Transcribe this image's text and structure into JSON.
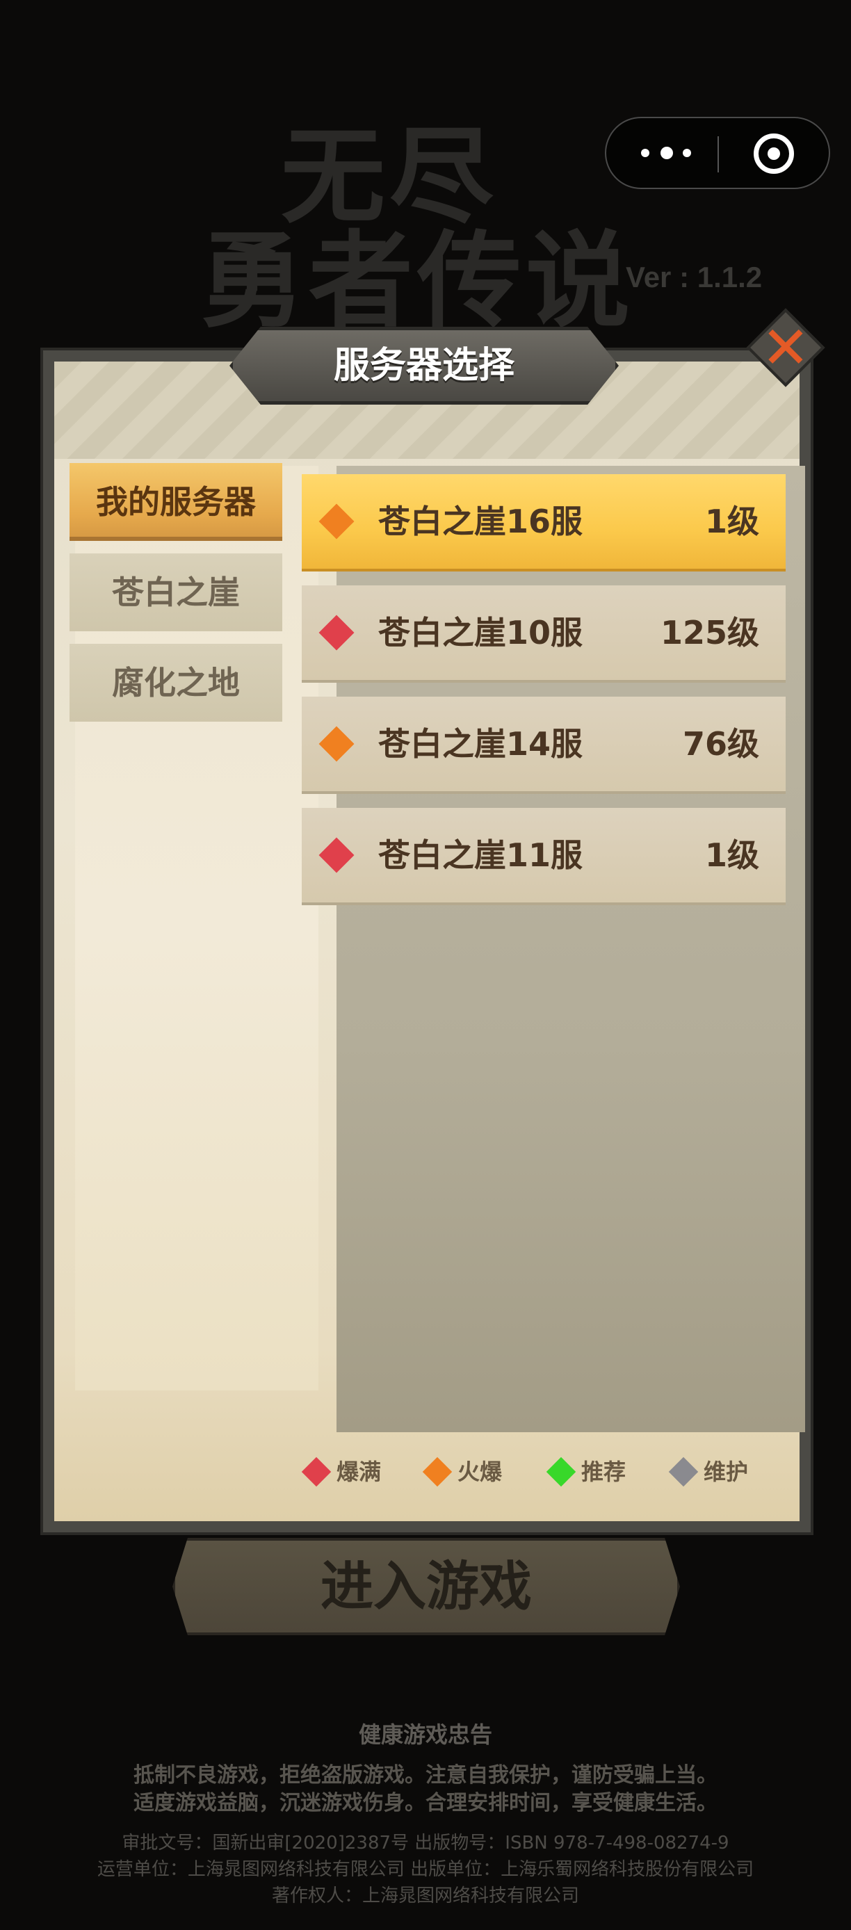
{
  "colors": {
    "accent_selected": "#fbc94b",
    "close_x": "#e45a26",
    "gem_full": "#e0404b",
    "gem_hot": "#f08020",
    "gem_recommend": "#38d82a",
    "gem_maintenance": "#8a8a8f"
  },
  "capsule": {
    "more_icon": "more-dots-icon",
    "close_icon": "target-icon"
  },
  "logo": {
    "line1": "无尽",
    "line2": "勇者传说",
    "version": "Ver : 1.1.2"
  },
  "dialog": {
    "title": "服务器选择",
    "close_icon": "close-x-icon",
    "tabs": [
      {
        "label": "我的服务器",
        "active": true
      },
      {
        "label": "苍白之崖",
        "active": false
      },
      {
        "label": "腐化之地",
        "active": false
      }
    ],
    "servers": [
      {
        "name": "苍白之崖16服",
        "level": "1级",
        "status": "hot",
        "selected": true
      },
      {
        "name": "苍白之崖10服",
        "level": "125级",
        "status": "full",
        "selected": false
      },
      {
        "name": "苍白之崖14服",
        "level": "76级",
        "status": "hot",
        "selected": false
      },
      {
        "name": "苍白之崖11服",
        "level": "1级",
        "status": "full",
        "selected": false
      }
    ],
    "legend": [
      {
        "label": "爆满",
        "status": "full"
      },
      {
        "label": "火爆",
        "status": "hot"
      },
      {
        "label": "推荐",
        "status": "recommend"
      },
      {
        "label": "维护",
        "status": "maintenance"
      }
    ]
  },
  "enter_button": {
    "label": "进入游戏"
  },
  "footer": {
    "title": "健康游戏忠告",
    "line1": "抵制不良游戏，拒绝盗版游戏。注意自我保护，谨防受骗上当。",
    "line2": "适度游戏益脑，沉迷游戏伤身。合理安排时间，享受健康生活。",
    "approval": "审批文号：国新出审[2020]2387号  出版物号：ISBN 978-7-498-08274-9",
    "operator": "运营单位：上海晁图网络科技有限公司 出版单位：上海乐蜀网络科技股份有限公司",
    "copyright": "著作权人：上海晁图网络科技有限公司"
  }
}
